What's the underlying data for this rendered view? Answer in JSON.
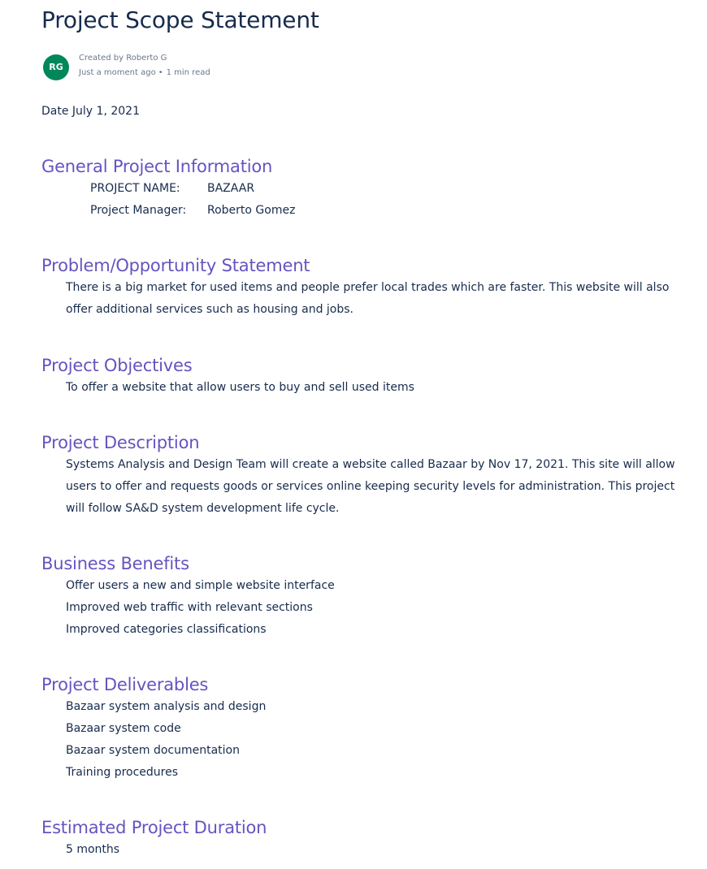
{
  "page": {
    "title": "Project Scope Statement"
  },
  "byline": {
    "avatar_initials": "RG",
    "avatar_color": "#00875a",
    "created_by": "Created by Roberto G",
    "when": "Just a moment ago",
    "separator": "•",
    "read_time": "1 min read"
  },
  "date_line": "Date July 1, 2021",
  "colors": {
    "heading": "#6554c0",
    "text": "#172b4d",
    "muted": "#6b778c"
  },
  "sections": {
    "general": {
      "heading": "General Project Information",
      "rows": [
        {
          "key": "PROJECT NAME:",
          "value": "BAZAAR"
        },
        {
          "key": "Project Manager:",
          "value": "Roberto Gomez"
        }
      ]
    },
    "problem": {
      "heading": "Problem/Opportunity Statement",
      "text": "There is a big market for used items and people prefer local trades which are faster. This website will also offer additional services such as housing and jobs."
    },
    "objectives": {
      "heading": "Project Objectives",
      "text": "To offer a website that allow users to buy and sell used items"
    },
    "description": {
      "heading": "Project Description",
      "text": "Systems Analysis and Design Team will create a website called Bazaar by Nov 17, 2021. This site will allow users to offer and requests goods or services online keeping security levels for administration. This project will follow SA&D system development life cycle."
    },
    "benefits": {
      "heading": "Business Benefits",
      "items": [
        "Offer users a new and simple website interface",
        "Improved web traffic with relevant sections",
        "Improved categories classifications"
      ]
    },
    "deliverables": {
      "heading": "Project Deliverables",
      "items": [
        "Bazaar system analysis and design",
        "Bazaar system code",
        "Bazaar system documentation",
        "Training procedures"
      ]
    },
    "duration": {
      "heading": "Estimated Project Duration",
      "text": "5 months"
    }
  }
}
